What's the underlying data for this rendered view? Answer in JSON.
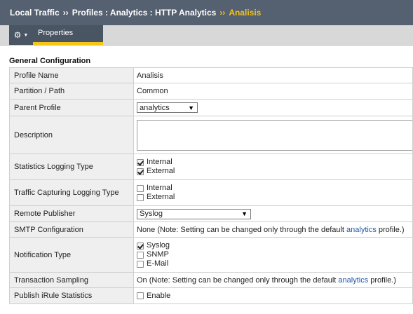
{
  "breadcrumb": {
    "part1": "Local Traffic",
    "sep": "››",
    "part2": "Profiles : Analytics : HTTP Analytics",
    "current": "Analisis"
  },
  "tabs": {
    "gear_icon": "gear-icon",
    "properties": "Properties"
  },
  "section_title": "General Configuration",
  "rows": {
    "profile_name": {
      "label": "Profile Name",
      "value": "Analisis"
    },
    "partition": {
      "label": "Partition / Path",
      "value": "Common"
    },
    "parent_profile": {
      "label": "Parent Profile",
      "value": "analytics"
    },
    "description": {
      "label": "Description",
      "value": ""
    },
    "stats_logging": {
      "label": "Statistics Logging Type",
      "options": [
        {
          "label": "Internal",
          "checked": true
        },
        {
          "label": "External",
          "checked": true
        }
      ]
    },
    "traffic_capture": {
      "label": "Traffic Capturing Logging Type",
      "options": [
        {
          "label": "Internal",
          "checked": false
        },
        {
          "label": "External",
          "checked": false
        }
      ]
    },
    "remote_publisher": {
      "label": "Remote Publisher",
      "value": "Syslog"
    },
    "smtp": {
      "label": "SMTP Configuration",
      "prefix": "None (Note: Setting can be changed only through the default ",
      "link": "analytics",
      "suffix": " profile.)"
    },
    "notification": {
      "label": "Notification Type",
      "options": [
        {
          "label": "Syslog",
          "checked": true
        },
        {
          "label": "SNMP",
          "checked": false
        },
        {
          "label": "E-Mail",
          "checked": false
        }
      ]
    },
    "sampling": {
      "label": "Transaction Sampling",
      "prefix": "On (Note: Setting can be changed only through the default ",
      "link": "analytics",
      "suffix": " profile.)"
    },
    "irule": {
      "label": "Publish iRule Statistics",
      "option": {
        "label": "Enable",
        "checked": false
      }
    }
  },
  "colors": {
    "titlebar": "#556070",
    "accent": "#f5c518",
    "link": "#2257a5"
  }
}
